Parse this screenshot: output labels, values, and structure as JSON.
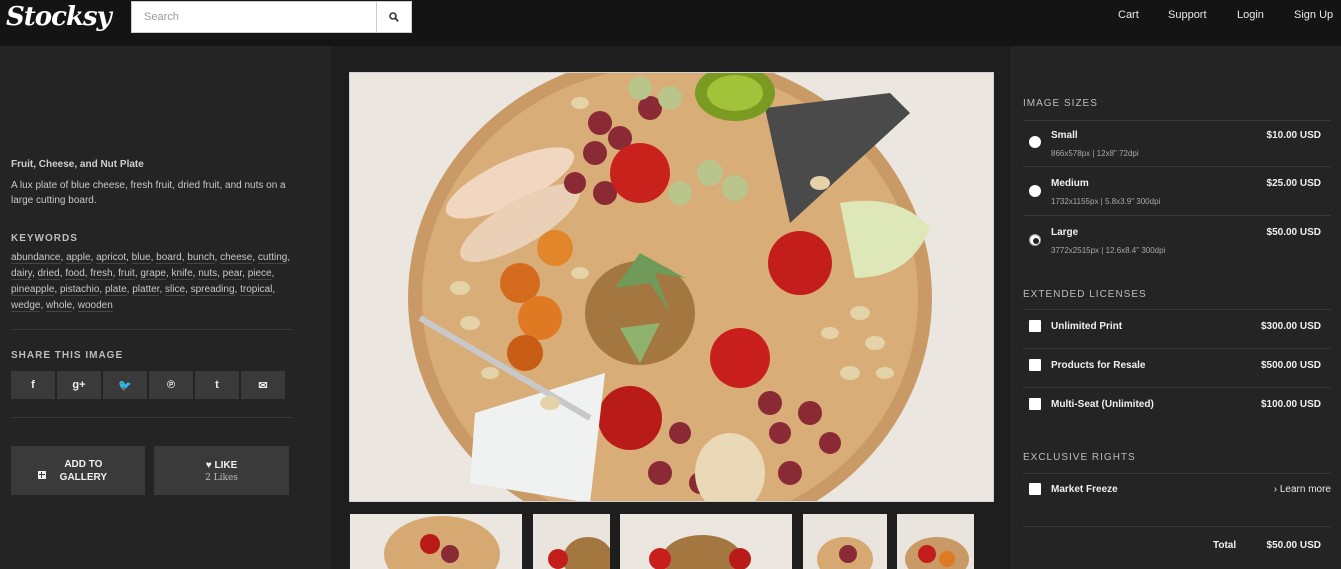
{
  "brand": {
    "logo": "Stocksy"
  },
  "search": {
    "placeholder": "Search",
    "icon": "search-icon"
  },
  "nav": {
    "cart": "Cart",
    "support": "Support",
    "login": "Login",
    "signup": "Sign Up"
  },
  "image": {
    "title": "Fruit, Cheese, and Nut Plate",
    "description": "A lux plate of blue cheese, fresh fruit, dried fruit, and nuts on a large cutting board."
  },
  "keywords": {
    "label": "KEYWORDS",
    "items": [
      "abundance",
      "apple",
      "apricot",
      "blue",
      "board",
      "bunch",
      "cheese",
      "cutting",
      "dairy",
      "dried",
      "food",
      "fresh",
      "fruit",
      "grape",
      "knife",
      "nuts",
      "pear",
      "piece",
      "pineapple",
      "pistachio",
      "plate",
      "platter",
      "slice",
      "spreading",
      "tropical",
      "wedge",
      "whole",
      "wooden"
    ]
  },
  "share": {
    "label": "SHARE THIS IMAGE",
    "buttons": [
      {
        "name": "facebook-icon",
        "glyph": "f"
      },
      {
        "name": "google-plus-icon",
        "glyph": "g+"
      },
      {
        "name": "twitter-icon",
        "glyph": "🐦"
      },
      {
        "name": "pinterest-icon",
        "glyph": "℗"
      },
      {
        "name": "tumblr-icon",
        "glyph": "t"
      },
      {
        "name": "email-icon",
        "glyph": "✉"
      }
    ]
  },
  "actions": {
    "add_to_gallery": {
      "icon": "plus-square-icon",
      "label": "ADD TO GALLERY"
    },
    "like": {
      "icon": "heart-icon",
      "label": "LIKE",
      "count": "2 Likes"
    }
  },
  "image_sizes": {
    "label": "IMAGE SIZES",
    "options": [
      {
        "name": "Small",
        "spec": "866x578px | 12x8\" 72dpi",
        "price": "$10.00 USD",
        "selected": false
      },
      {
        "name": "Medium",
        "spec": "1732x1155px | 5.8x3.9\" 300dpi",
        "price": "$25.00 USD",
        "selected": false
      },
      {
        "name": "Large",
        "spec": "3772x2515px | 12.6x8.4\" 300dpi",
        "price": "$50.00 USD",
        "selected": true
      }
    ]
  },
  "extended_licenses": {
    "label": "EXTENDED LICENSES",
    "options": [
      {
        "name": "Unlimited Print",
        "price": "$300.00 USD"
      },
      {
        "name": "Products for Resale",
        "price": "$500.00 USD"
      },
      {
        "name": "Multi-Seat (Unlimited)",
        "price": "$100.00 USD"
      }
    ]
  },
  "exclusive_rights": {
    "label": "EXCLUSIVE RIGHTS",
    "option": "Market Freeze",
    "learn_more": "Learn more"
  },
  "total": {
    "label": "Total",
    "value": "$50.00 USD"
  },
  "colors": {
    "topbar": "#141414",
    "panel": "#242424",
    "button": "#3a3a3a",
    "text": "#f0f0f0"
  }
}
